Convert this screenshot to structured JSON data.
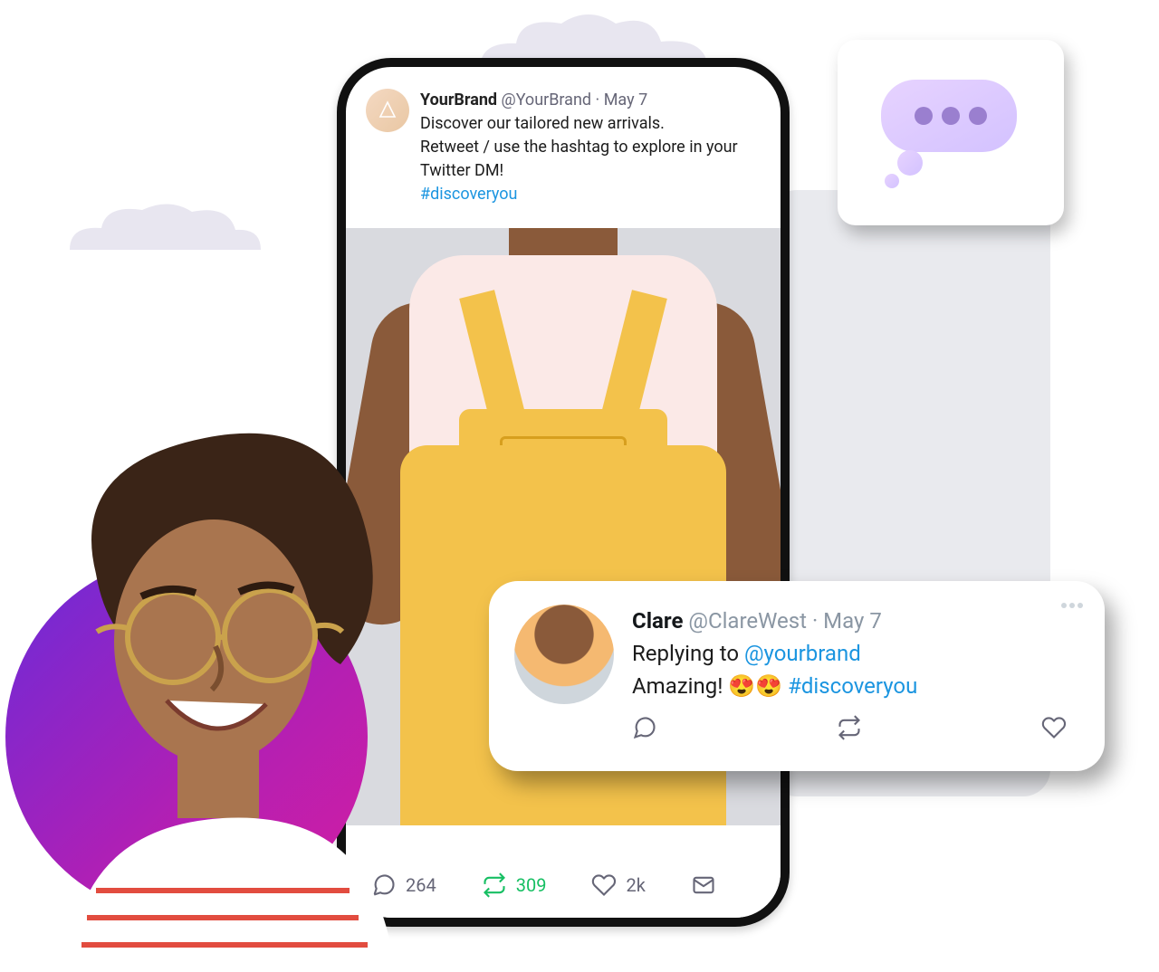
{
  "main_tweet": {
    "brand": "YourBrand",
    "handle": "@YourBrand",
    "date": "May 7",
    "line1": "Discover our tailored new arrivals.",
    "line2": "Retweet / use the hashtag to explore in your Twitter DM!",
    "hashtag": "#discoveryou",
    "replies": "264",
    "retweets": "309",
    "likes": "2k"
  },
  "reply": {
    "name": "Clare",
    "handle": "@ClareWest",
    "date": "May 7",
    "replying_to_label": "Replying to",
    "replying_to_handle": "@yourbrand",
    "text_prefix": "Amazing! ",
    "emoji": "😍😍",
    "hashtag": "#discoveryou"
  }
}
